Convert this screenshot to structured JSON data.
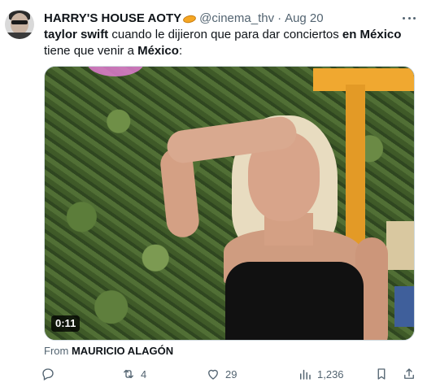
{
  "tweet": {
    "display_name": "HARRY'S HOUSE AOTY",
    "handle": "@cinema_thv",
    "separator": "·",
    "date": "Aug 20",
    "text_parts": [
      "taylor swift",
      " cuando le dijieron que para dar conciertos ",
      "en México",
      " tiene que venir a ",
      "México",
      ":"
    ],
    "media": {
      "duration": "0:11"
    },
    "from_prefix": "From ",
    "from_name": "MAURICIO ALAGÓN",
    "actions": {
      "replies": "",
      "retweets": "4",
      "likes": "29",
      "views": "1,236"
    }
  },
  "icons": {
    "avatar": "profile-photo",
    "badge": "flying-saucer-emoji",
    "more": "more-icon",
    "reply": "reply-icon",
    "retweet": "retweet-icon",
    "like": "heart-icon",
    "views": "views-icon",
    "bookmark": "bookmark-icon",
    "share": "share-icon"
  },
  "colors": {
    "text_primary": "#0f1419",
    "text_secondary": "#536471",
    "border": "#cfd9de"
  }
}
